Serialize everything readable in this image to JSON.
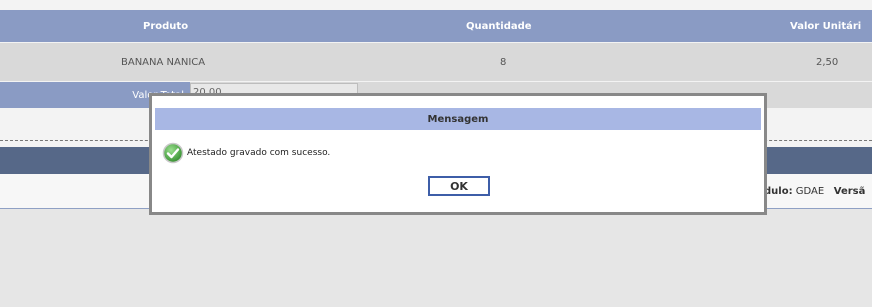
{
  "table": {
    "headers": [
      "Produto",
      "Quantidade",
      "Valor Unitári"
    ],
    "rows": [
      {
        "produto": "BANANA NANICA",
        "quantidade": "8",
        "valor_unitario": "2,50"
      }
    ],
    "total_label": "Valor Total",
    "total_value": "20,00"
  },
  "footer": {
    "modulo_label": "dulo:",
    "modulo_value": "GDAE",
    "versao_label": "Versã"
  },
  "modal": {
    "title": "Mensagem",
    "message": "Atestado gravado com sucesso.",
    "ok_label": "OK"
  },
  "colors": {
    "header_bg": "#8a9bc4",
    "modal_title_bg": "#a8b7e4",
    "ok_border": "#3e5ea8",
    "success_green": "#3fa535"
  }
}
